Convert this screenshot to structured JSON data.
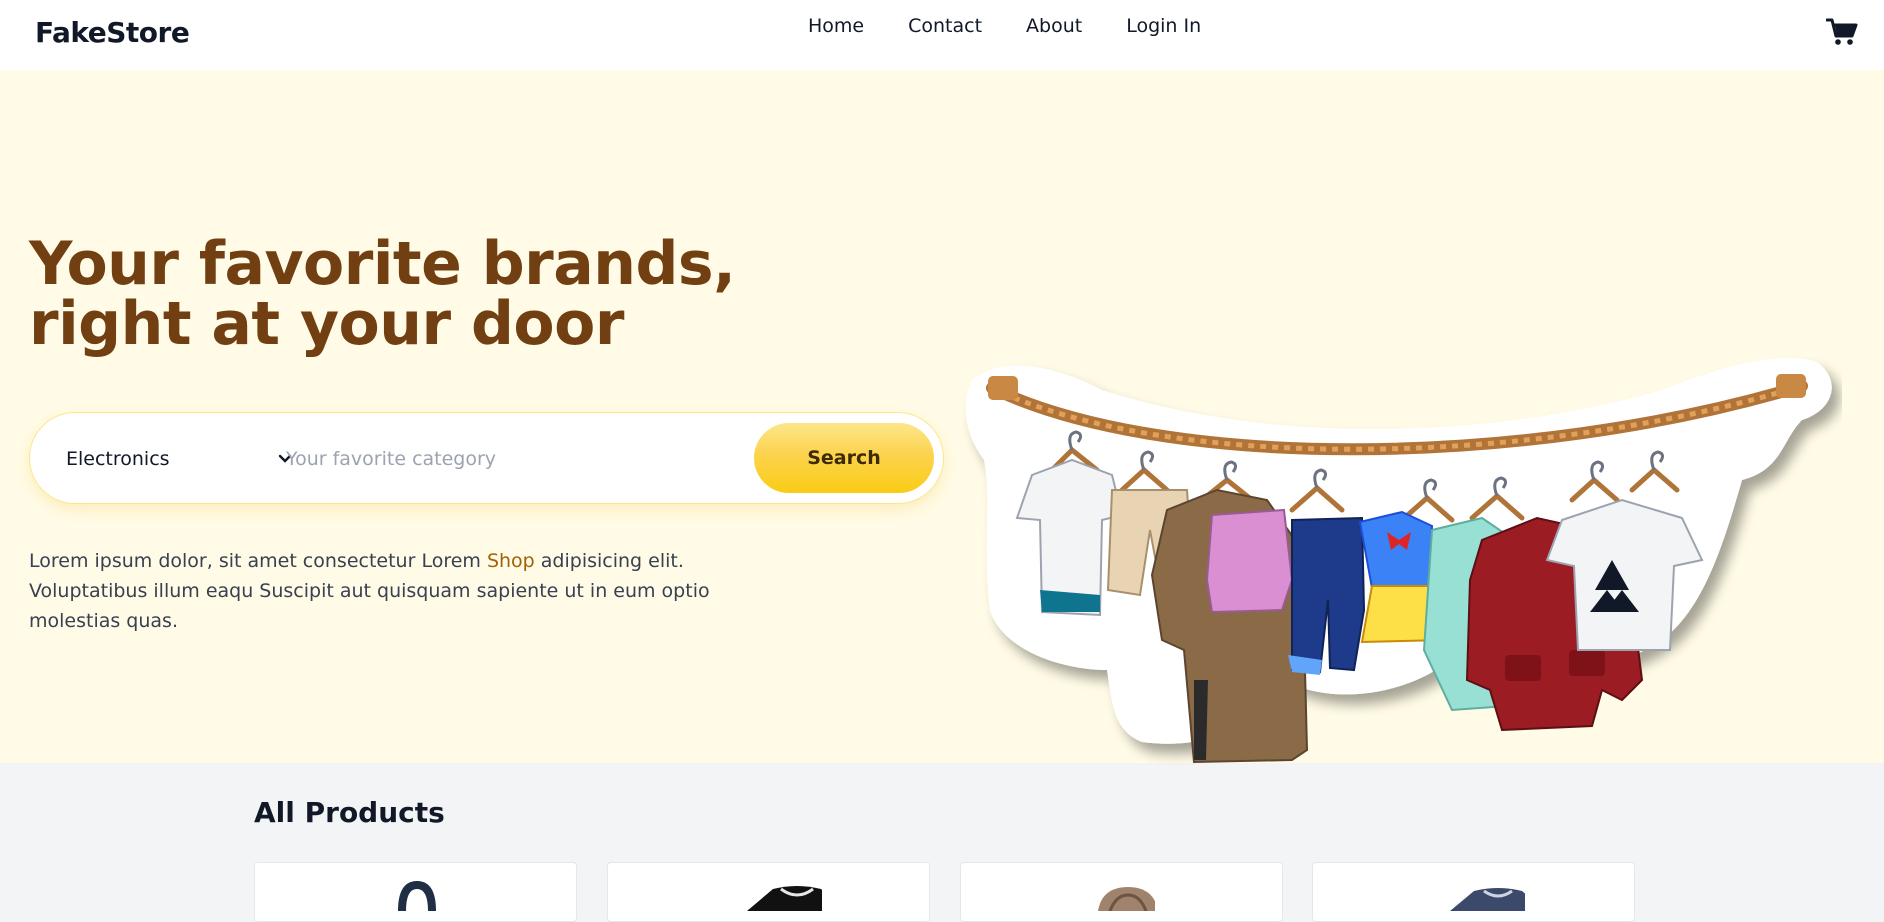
{
  "nav": {
    "brand": "FakeStore",
    "links": [
      "Home",
      "Contact",
      "About",
      "Login In"
    ],
    "cart_icon": "cart-icon"
  },
  "hero": {
    "title": "Your favorite brands, right at your door",
    "search": {
      "selected_category": "Electronics",
      "placeholder": "Your favorite category",
      "button_label": "Search"
    },
    "description_before": "Lorem ipsum dolor, sit amet consectetur Lorem ",
    "description_link": "Shop",
    "description_after": " adipisicing elit. Voluptatibus illum eaqu Suscipit aut quisquam sapiente ut in eum optio molestias quas.",
    "illustration": "clothesline-illustration"
  },
  "products": {
    "title": "All Products"
  },
  "colors": {
    "hero_bg": "#fffbe6",
    "title_brown": "#713f12",
    "button_yellow": "#facc15",
    "link_gold": "#a16207"
  }
}
